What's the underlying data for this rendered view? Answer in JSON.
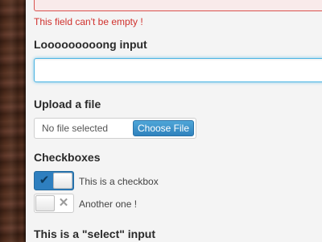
{
  "form": {
    "error_message": "This field can't be empty !",
    "long_label": "Looooooooong input",
    "long_value": "",
    "upload_label": "Upload a file",
    "file_status": "No file selected",
    "file_button": "Choose File",
    "checkboxes_label": "Checkboxes",
    "checkbox1": {
      "label": "This is a checkbox",
      "checked": true
    },
    "checkbox2": {
      "label": "Another one !",
      "checked": false
    },
    "select_label": "This is a \"select\" input"
  },
  "colors": {
    "error": "#d0312d",
    "focus": "#4fb6e4",
    "primary": "#2e7fbf"
  },
  "icons": {
    "check": "check-icon",
    "cross": "cross-icon"
  }
}
